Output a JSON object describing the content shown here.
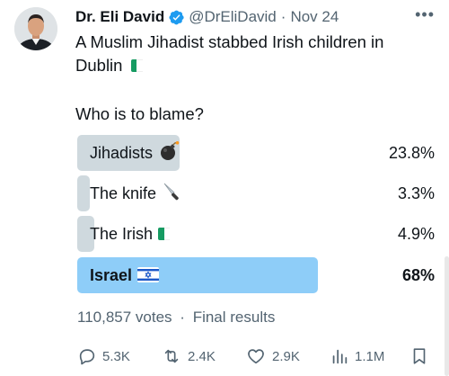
{
  "tweet": {
    "author_name": "Dr. Eli David",
    "handle": "@DrEliDavid",
    "separator": "·",
    "date": "Nov 24",
    "more": "•••",
    "text": "A Muslim Jihadist stabbed Irish children in Dublin"
  },
  "poll": {
    "question": "Who is to blame?",
    "options": [
      {
        "label": "Jihadists",
        "percent_text": "23.8%",
        "percent": 23.8,
        "emoji": "bomb-icon",
        "winner": false
      },
      {
        "label": "The knife",
        "percent_text": "3.3%",
        "percent": 3.3,
        "emoji": "knife-icon",
        "winner": false
      },
      {
        "label": "The Irish",
        "percent_text": "4.9%",
        "percent": 4.9,
        "emoji": "ireland-flag-icon",
        "winner": false
      },
      {
        "label": "Israel",
        "percent_text": "68%",
        "percent": 68,
        "emoji": "israel-flag-icon",
        "winner": true
      }
    ],
    "votes": "110,857 votes",
    "separator": "·",
    "status": "Final results"
  },
  "actions": {
    "replies": "5.3K",
    "reposts": "2.4K",
    "likes": "2.9K",
    "views": "1.1M"
  },
  "colors": {
    "bar": "#cfd9de",
    "winner_bar": "#8ecdf8",
    "verified": "#1d9bf0",
    "secondary_text": "#536471"
  }
}
